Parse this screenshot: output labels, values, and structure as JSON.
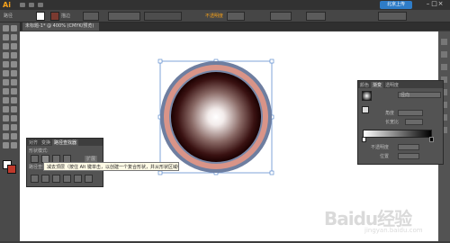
{
  "app": {
    "logo": "Ai"
  },
  "topbar": {
    "sync_label": "北京上传",
    "window_buttons": [
      "–",
      "□",
      "×"
    ]
  },
  "control_bar": {
    "left_label": "路径",
    "fill_label": "描边",
    "opacity_label": "不透明度"
  },
  "document": {
    "tab_label": "未标题-1* @ 400% (CMYK/预览)"
  },
  "gradient_panel": {
    "tabs": [
      "颜色",
      "渐变",
      "透明度"
    ],
    "type_value": "径向",
    "angle_label": "角度",
    "ratio_label": "长宽比",
    "opacity_label": "不透明度",
    "location_label": "位置"
  },
  "pathfinder_panel": {
    "tabs": [
      "对齐",
      "变换",
      "路径查找器"
    ],
    "shape_modes_label": "形状模式:",
    "pathfinders_label": "路径查找器:",
    "expand_label": "扩展",
    "tooltip": "减去顶层（按住 Alt 键单击，以创建一个复合形状，并从形状区域中减去）"
  },
  "artwork": {
    "gradient_center": "#ffffff",
    "gradient_mid": "#8a6a66",
    "gradient_edge": "#1a0000",
    "ring_outer_color": "#6e7ea0",
    "ring_color": "#d99488",
    "selection_color": "#4a7ec8"
  },
  "watermark": {
    "text": "Baidu经验",
    "sub": "jingyan.baidu.com"
  },
  "colors": {
    "accent": "#f7a21b",
    "sync_blue": "#2e7cc7"
  }
}
